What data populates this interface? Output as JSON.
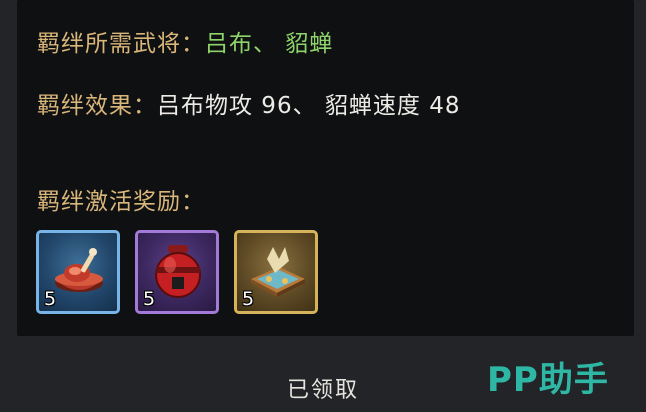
{
  "bond": {
    "required_label": "羁绊所需武将：",
    "required_heroes": "吕布、 貂蝉",
    "effect_label": "羁绊效果：",
    "effect_text": "吕布物攻 96、 貂蝉速度 48",
    "reward_label": "羁绊激活奖励："
  },
  "rewards": [
    {
      "icon": "meat-bowl-icon",
      "count": "5",
      "quality_color": "#79b4e8"
    },
    {
      "icon": "wine-jar-icon",
      "count": "5",
      "quality_color": "#a47ad8"
    },
    {
      "icon": "treasure-box-icon",
      "count": "5",
      "quality_color": "#d6b25b"
    }
  ],
  "footer": {
    "claimed_label": "已领取"
  },
  "watermark": {
    "text": "PP助手"
  }
}
